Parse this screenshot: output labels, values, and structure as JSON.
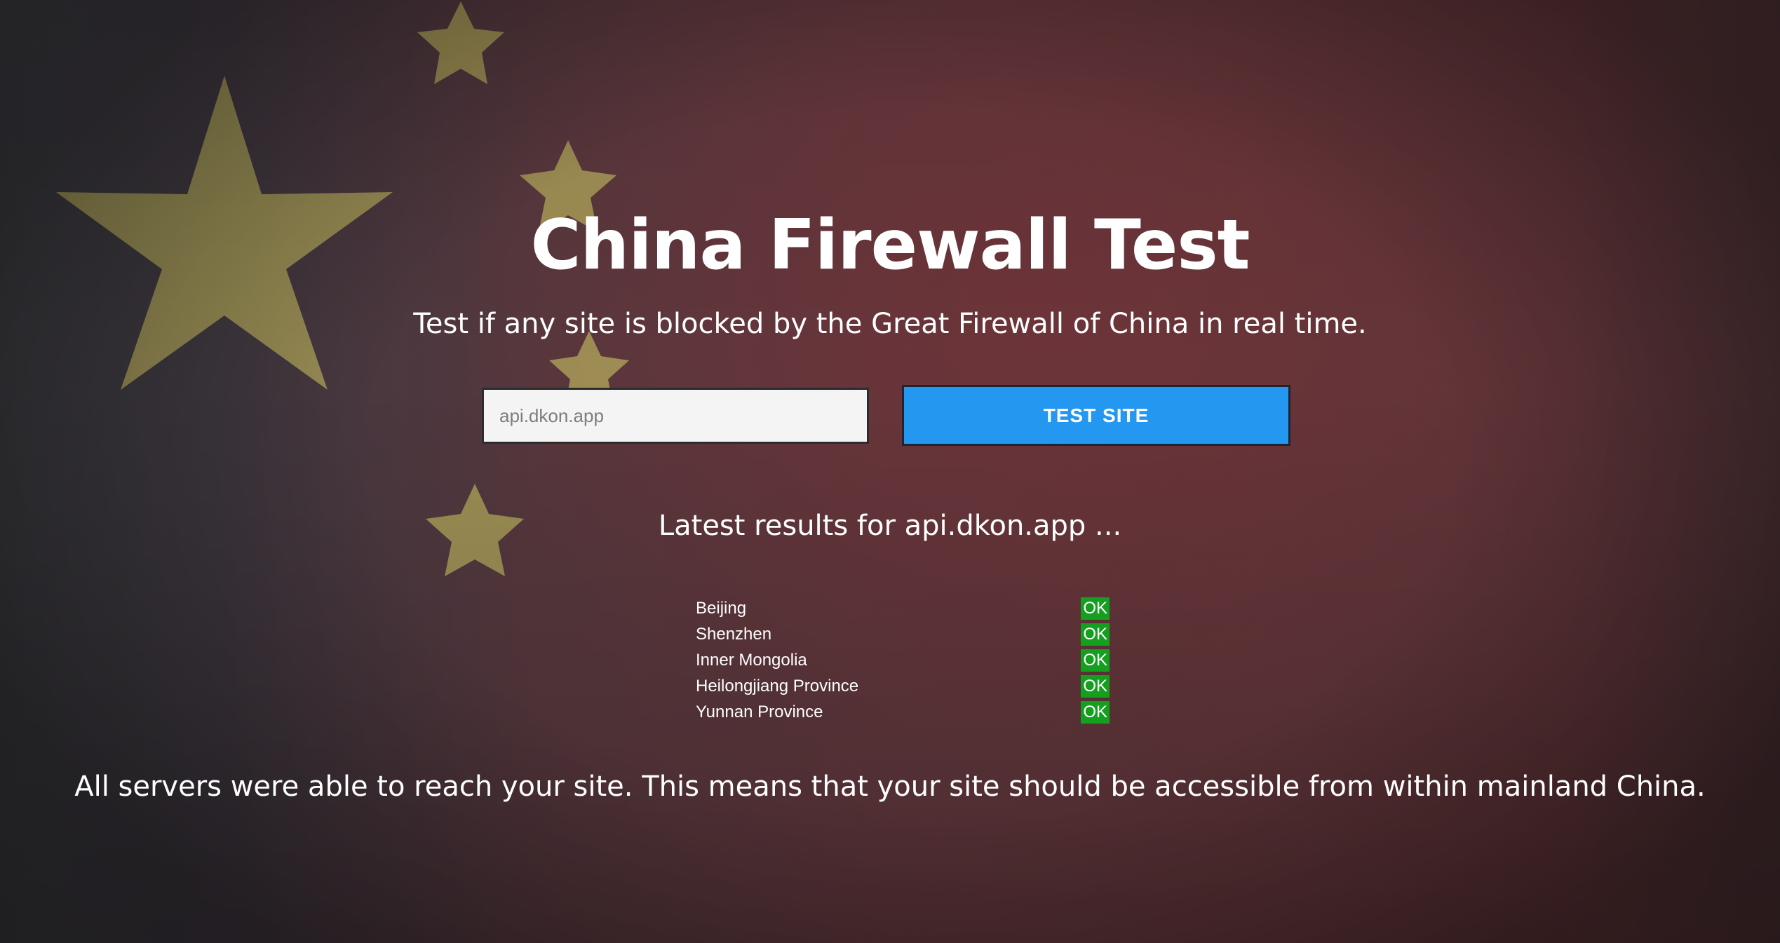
{
  "page": {
    "title": "China Firewall Test",
    "subtitle": "Test if any site is blocked by the Great Firewall of China in real time."
  },
  "search": {
    "value": "",
    "placeholder": "api.dkon.app",
    "button_label": "TEST SITE"
  },
  "results": {
    "heading": "Latest results for api.dkon.app ...",
    "rows": [
      {
        "location": "Beijing",
        "status": "OK"
      },
      {
        "location": "Shenzhen",
        "status": "OK"
      },
      {
        "location": "Inner Mongolia",
        "status": "OK"
      },
      {
        "location": "Heilongjiang Province",
        "status": "OK"
      },
      {
        "location": "Yunnan Province",
        "status": "OK"
      }
    ],
    "summary": "All servers were able to reach your site. This means that your site should be accessible from within mainland China."
  },
  "colors": {
    "button": "#2497f0",
    "ok_badge": "#14a01e",
    "background": "#5e363b",
    "star": "#b2a65c"
  }
}
